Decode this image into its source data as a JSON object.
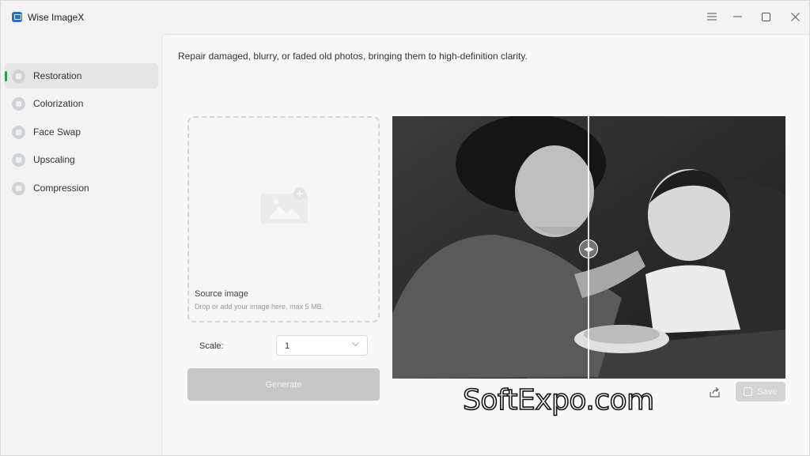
{
  "app": {
    "title": "Wise ImageX"
  },
  "titlebar": {
    "menu_icon": "hamburger-menu-icon",
    "minimize_icon": "minimize-icon",
    "maximize_icon": "maximize-icon",
    "close_icon": "close-icon"
  },
  "sidebar": {
    "items": [
      {
        "label": "Restoration",
        "icon": "restoration-icon",
        "active": true
      },
      {
        "label": "Colorization",
        "icon": "colorization-icon",
        "active": false
      },
      {
        "label": "Face Swap",
        "icon": "face-swap-icon",
        "active": false
      },
      {
        "label": "Upscaling",
        "icon": "upscaling-icon",
        "active": false
      },
      {
        "label": "Compression",
        "icon": "compression-icon",
        "active": false
      }
    ]
  },
  "main": {
    "description": "Repair damaged, blurry, or faded old photos, bringing them to high-definition clarity.",
    "dropzone": {
      "title": "Source image",
      "subtitle": "Drop or add your image here, max 5 MB."
    },
    "scale": {
      "label": "Scale:",
      "value": "1"
    },
    "generate_label": "Generate",
    "save_label": "Save",
    "watermark": "SoftExpo.com"
  },
  "colors": {
    "accent": "#2d9a3b",
    "brand": "#1e6fd9"
  }
}
